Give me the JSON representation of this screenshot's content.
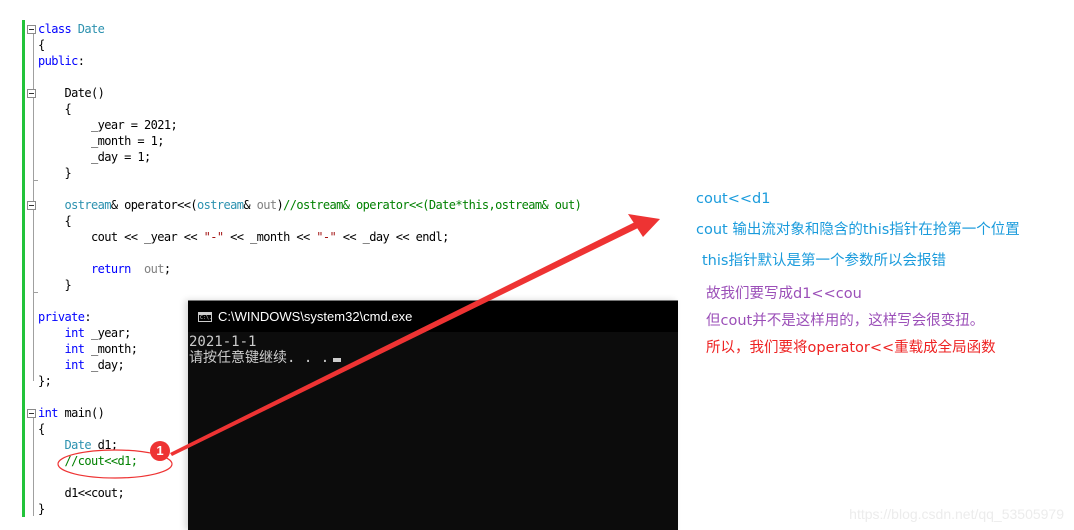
{
  "editor": {
    "lines": [
      {
        "tokens": [
          [
            "kw",
            "class"
          ],
          [
            "",
            ""
          ],
          [
            "ty",
            " Date"
          ]
        ]
      },
      {
        "tokens": [
          [
            "",
            "{"
          ]
        ]
      },
      {
        "tokens": [
          [
            "kw",
            "public"
          ],
          [
            "",
            ":"
          ]
        ]
      },
      {
        "tokens": []
      },
      {
        "tokens": [
          [
            "",
            "    Date()"
          ]
        ]
      },
      {
        "tokens": [
          [
            "",
            "    {"
          ]
        ]
      },
      {
        "tokens": [
          [
            "",
            "        _year = 2021;"
          ]
        ]
      },
      {
        "tokens": [
          [
            "",
            "        _month = 1;"
          ]
        ]
      },
      {
        "tokens": [
          [
            "",
            "        _day = 1;"
          ]
        ]
      },
      {
        "tokens": [
          [
            "",
            "    }"
          ]
        ]
      },
      {
        "tokens": []
      },
      {
        "tokens": [
          [
            "ty",
            "    ostream"
          ],
          [
            "",
            "& operator<<("
          ],
          [
            "ty",
            "ostream"
          ],
          [
            "",
            "& "
          ],
          [
            "gr",
            "out"
          ],
          [
            "",
            ")"
          ],
          [
            "cm",
            "//ostream& operator<<(Date*this,ostream& out)"
          ]
        ]
      },
      {
        "tokens": [
          [
            "",
            "    {"
          ]
        ]
      },
      {
        "tokens": [
          [
            "",
            "        cout << _year << "
          ],
          [
            "st",
            "\"-\""
          ],
          [
            "",
            " << _month << "
          ],
          [
            "st",
            "\"-\""
          ],
          [
            "",
            " << _day << endl;"
          ]
        ]
      },
      {
        "tokens": []
      },
      {
        "tokens": [
          [
            "kw",
            "        return"
          ],
          [
            "gr",
            "  out"
          ],
          [
            "",
            ";"
          ]
        ]
      },
      {
        "tokens": [
          [
            "",
            "    }"
          ]
        ]
      },
      {
        "tokens": []
      },
      {
        "tokens": [
          [
            "kw",
            "private"
          ],
          [
            "",
            ":"
          ]
        ]
      },
      {
        "tokens": [
          [
            "kw",
            "    int"
          ],
          [
            "",
            " _year;"
          ]
        ]
      },
      {
        "tokens": [
          [
            "kw",
            "    int"
          ],
          [
            "",
            " _month;"
          ]
        ]
      },
      {
        "tokens": [
          [
            "kw",
            "    int"
          ],
          [
            "",
            " _day;"
          ]
        ]
      },
      {
        "tokens": [
          [
            "",
            "};"
          ]
        ]
      },
      {
        "tokens": []
      },
      {
        "tokens": [
          [
            "kw",
            "int"
          ],
          [
            "",
            " main()"
          ]
        ]
      },
      {
        "tokens": [
          [
            "",
            "{"
          ]
        ]
      },
      {
        "tokens": [
          [
            "ty",
            "    Date"
          ],
          [
            "",
            " d1;"
          ]
        ]
      },
      {
        "tokens": [
          [
            "cm",
            "    //cout<<d1;"
          ]
        ]
      },
      {
        "tokens": []
      },
      {
        "tokens": [
          [
            "",
            "    d1<<cout;"
          ]
        ]
      },
      {
        "tokens": [
          [
            "",
            "}"
          ]
        ]
      }
    ]
  },
  "console": {
    "title": "C:\\WINDOWS\\system32\\cmd.exe",
    "icon": "cmd-icon",
    "icon_text": "C:\\.",
    "output_lines": [
      "2021-1-1",
      "请按任意键继续. . ."
    ]
  },
  "annotations": {
    "badge_number": "1",
    "notes": [
      {
        "text": "cout<<d1",
        "color": "blue"
      },
      {
        "text": "cout 输出流对象和隐含的this指针在抢第一个位置",
        "color": "blue"
      },
      {
        "text": "this指针默认是第一个参数所以会报错",
        "color": "blue"
      },
      {
        "text": "故我们要写成d1<<cou",
        "color": "purple"
      },
      {
        "text": "但cout并不是这样用的，这样写会很变扭。",
        "color": "purple"
      },
      {
        "text": "所以，我们要将operator<<重载成全局函数",
        "color": "red"
      }
    ]
  },
  "watermark": "https://blog.csdn.net/qq_53505979",
  "colors": {
    "keyword": "#0000ff",
    "type": "#2b91af",
    "comment": "#008000",
    "string": "#a31515",
    "annotation_red": "#ee3333",
    "change_bar": "#22c33a"
  }
}
